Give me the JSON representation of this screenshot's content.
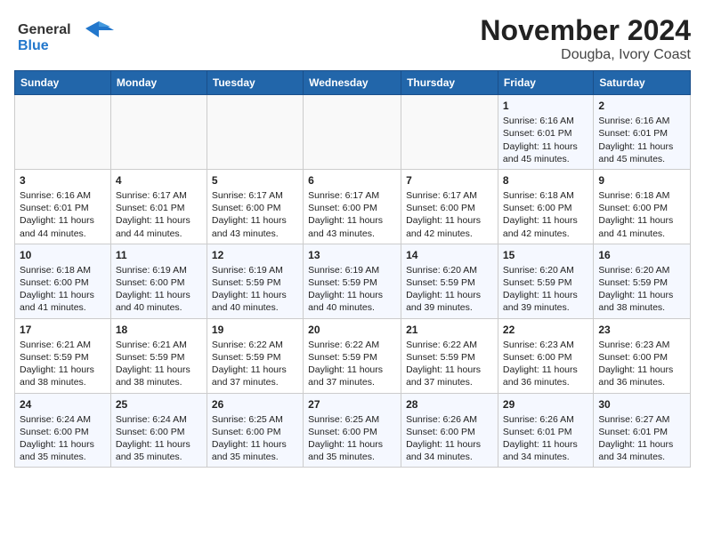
{
  "logo": {
    "line1": "General",
    "line2": "Blue"
  },
  "title": "November 2024",
  "subtitle": "Dougba, Ivory Coast",
  "days_of_week": [
    "Sunday",
    "Monday",
    "Tuesday",
    "Wednesday",
    "Thursday",
    "Friday",
    "Saturday"
  ],
  "weeks": [
    [
      {
        "day": "",
        "info": ""
      },
      {
        "day": "",
        "info": ""
      },
      {
        "day": "",
        "info": ""
      },
      {
        "day": "",
        "info": ""
      },
      {
        "day": "",
        "info": ""
      },
      {
        "day": "1",
        "info": "Sunrise: 6:16 AM\nSunset: 6:01 PM\nDaylight: 11 hours and 45 minutes."
      },
      {
        "day": "2",
        "info": "Sunrise: 6:16 AM\nSunset: 6:01 PM\nDaylight: 11 hours and 45 minutes."
      }
    ],
    [
      {
        "day": "3",
        "info": "Sunrise: 6:16 AM\nSunset: 6:01 PM\nDaylight: 11 hours and 44 minutes."
      },
      {
        "day": "4",
        "info": "Sunrise: 6:17 AM\nSunset: 6:01 PM\nDaylight: 11 hours and 44 minutes."
      },
      {
        "day": "5",
        "info": "Sunrise: 6:17 AM\nSunset: 6:00 PM\nDaylight: 11 hours and 43 minutes."
      },
      {
        "day": "6",
        "info": "Sunrise: 6:17 AM\nSunset: 6:00 PM\nDaylight: 11 hours and 43 minutes."
      },
      {
        "day": "7",
        "info": "Sunrise: 6:17 AM\nSunset: 6:00 PM\nDaylight: 11 hours and 42 minutes."
      },
      {
        "day": "8",
        "info": "Sunrise: 6:18 AM\nSunset: 6:00 PM\nDaylight: 11 hours and 42 minutes."
      },
      {
        "day": "9",
        "info": "Sunrise: 6:18 AM\nSunset: 6:00 PM\nDaylight: 11 hours and 41 minutes."
      }
    ],
    [
      {
        "day": "10",
        "info": "Sunrise: 6:18 AM\nSunset: 6:00 PM\nDaylight: 11 hours and 41 minutes."
      },
      {
        "day": "11",
        "info": "Sunrise: 6:19 AM\nSunset: 6:00 PM\nDaylight: 11 hours and 40 minutes."
      },
      {
        "day": "12",
        "info": "Sunrise: 6:19 AM\nSunset: 5:59 PM\nDaylight: 11 hours and 40 minutes."
      },
      {
        "day": "13",
        "info": "Sunrise: 6:19 AM\nSunset: 5:59 PM\nDaylight: 11 hours and 40 minutes."
      },
      {
        "day": "14",
        "info": "Sunrise: 6:20 AM\nSunset: 5:59 PM\nDaylight: 11 hours and 39 minutes."
      },
      {
        "day": "15",
        "info": "Sunrise: 6:20 AM\nSunset: 5:59 PM\nDaylight: 11 hours and 39 minutes."
      },
      {
        "day": "16",
        "info": "Sunrise: 6:20 AM\nSunset: 5:59 PM\nDaylight: 11 hours and 38 minutes."
      }
    ],
    [
      {
        "day": "17",
        "info": "Sunrise: 6:21 AM\nSunset: 5:59 PM\nDaylight: 11 hours and 38 minutes."
      },
      {
        "day": "18",
        "info": "Sunrise: 6:21 AM\nSunset: 5:59 PM\nDaylight: 11 hours and 38 minutes."
      },
      {
        "day": "19",
        "info": "Sunrise: 6:22 AM\nSunset: 5:59 PM\nDaylight: 11 hours and 37 minutes."
      },
      {
        "day": "20",
        "info": "Sunrise: 6:22 AM\nSunset: 5:59 PM\nDaylight: 11 hours and 37 minutes."
      },
      {
        "day": "21",
        "info": "Sunrise: 6:22 AM\nSunset: 5:59 PM\nDaylight: 11 hours and 37 minutes."
      },
      {
        "day": "22",
        "info": "Sunrise: 6:23 AM\nSunset: 6:00 PM\nDaylight: 11 hours and 36 minutes."
      },
      {
        "day": "23",
        "info": "Sunrise: 6:23 AM\nSunset: 6:00 PM\nDaylight: 11 hours and 36 minutes."
      }
    ],
    [
      {
        "day": "24",
        "info": "Sunrise: 6:24 AM\nSunset: 6:00 PM\nDaylight: 11 hours and 35 minutes."
      },
      {
        "day": "25",
        "info": "Sunrise: 6:24 AM\nSunset: 6:00 PM\nDaylight: 11 hours and 35 minutes."
      },
      {
        "day": "26",
        "info": "Sunrise: 6:25 AM\nSunset: 6:00 PM\nDaylight: 11 hours and 35 minutes."
      },
      {
        "day": "27",
        "info": "Sunrise: 6:25 AM\nSunset: 6:00 PM\nDaylight: 11 hours and 35 minutes."
      },
      {
        "day": "28",
        "info": "Sunrise: 6:26 AM\nSunset: 6:00 PM\nDaylight: 11 hours and 34 minutes."
      },
      {
        "day": "29",
        "info": "Sunrise: 6:26 AM\nSunset: 6:01 PM\nDaylight: 11 hours and 34 minutes."
      },
      {
        "day": "30",
        "info": "Sunrise: 6:27 AM\nSunset: 6:01 PM\nDaylight: 11 hours and 34 minutes."
      }
    ]
  ]
}
